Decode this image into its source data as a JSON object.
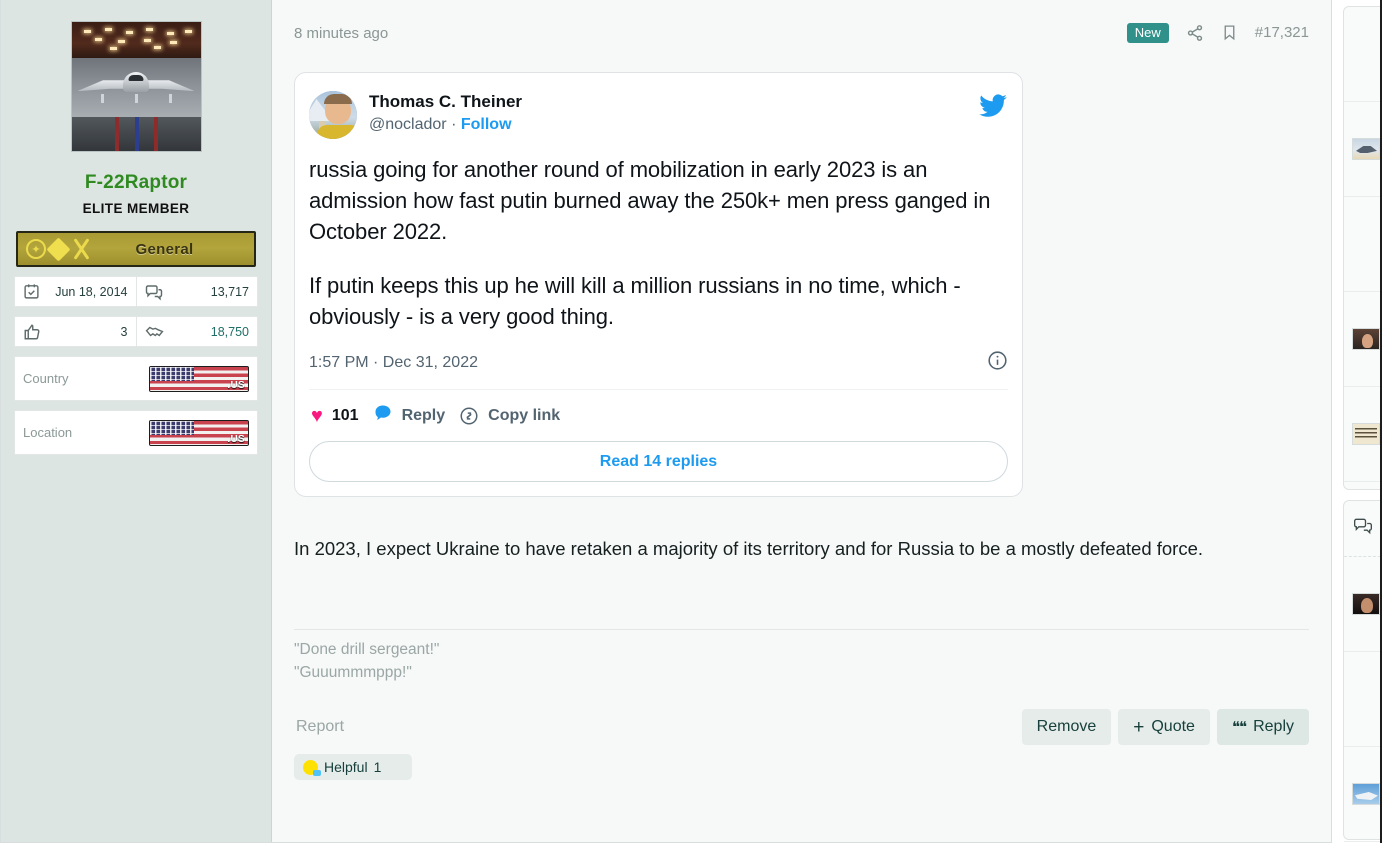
{
  "post": {
    "time_ago": "8 minutes ago",
    "badge_new": "New",
    "post_number": "#17,321",
    "share_icon": "share-icon",
    "bookmark_icon": "bookmark-icon"
  },
  "user": {
    "avatar_alt": "stealth-bomber-in-hangar",
    "name": "F-22Raptor",
    "title": "ELITE MEMBER",
    "rank_label": "General",
    "stats": [
      {
        "icon": "calendar-check-icon",
        "value": "Jun 18, 2014",
        "teal": false
      },
      {
        "icon": "comments-icon",
        "value": "13,717",
        "teal": false
      },
      {
        "icon": "thumbs-up-icon",
        "value": "3",
        "teal": false
      },
      {
        "icon": "handshake-icon",
        "value": "18,750",
        "teal": true
      }
    ],
    "info": [
      {
        "label": "Country",
        "flag_tld": ".US"
      },
      {
        "label": "Location",
        "flag_tld": ".US"
      }
    ]
  },
  "tweet": {
    "display_name": "Thomas C. Theiner",
    "handle": "@noclador",
    "separator": "·",
    "follow_label": "Follow",
    "bird_icon": "twitter-bird-icon",
    "body_paragraphs": [
      "russia going for another round of mobilization in early 2023 is an admission how fast putin burned away the 250k+ men press ganged in October 2022.",
      "If putin keeps this up he will kill a million russians in no time, which - obviously - is a very good thing."
    ],
    "timestamp": "1:57 PM · Dec 31, 2022",
    "info_icon": "info-circle-icon",
    "like_count": "101",
    "like_icon": "heart-icon",
    "reply_label": "Reply",
    "reply_icon": "speech-bubble-icon",
    "copy_link_label": "Copy link",
    "copy_link_icon": "link-icon",
    "read_replies_label": "Read 14 replies"
  },
  "content": {
    "text": "In 2023, I expect Ukraine to have retaken a majority of its territory and for Russia to be a mostly defeated force.",
    "signature_line1": "\"Done drill sergeant!\"",
    "signature_line2": "\"Guuummmppp!\""
  },
  "footer": {
    "report_label": "Report",
    "remove_label": "Remove",
    "quote_label": "Quote",
    "quote_plus": "+",
    "reply_label": "Reply",
    "reply_quote_mark": "❝❝",
    "helpful_label": "Helpful",
    "helpful_count": "1"
  },
  "colors": {
    "accent_teal": "#2f9189",
    "username_green": "#2f8a21",
    "twitter_blue": "#1d9bf0",
    "heart_pink": "#f91880",
    "sidebar_bg": "#dde5e2",
    "body_bg": "#f7f8f8"
  }
}
